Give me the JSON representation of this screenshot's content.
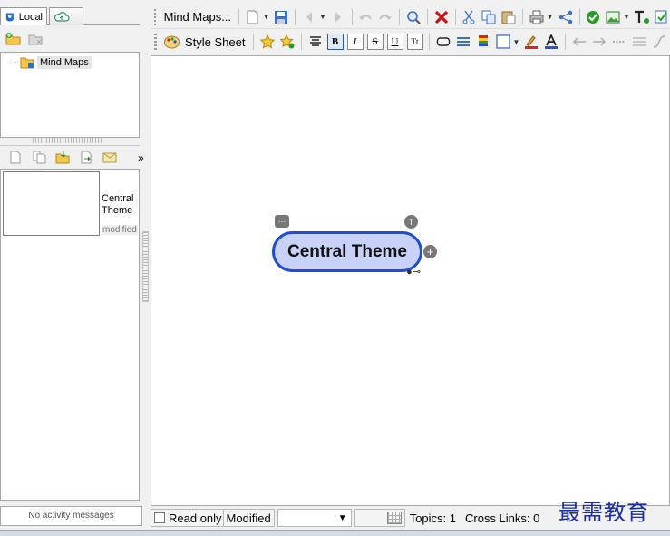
{
  "left_panel": {
    "tabs": [
      {
        "label": "Local",
        "icon": "local-library-icon"
      },
      {
        "label": "",
        "icon": "cloud-icon"
      }
    ],
    "tree": {
      "item_label": "Mind Maps"
    },
    "file": {
      "title": "Central Theme",
      "status": "modified"
    },
    "activity": "No activity messages"
  },
  "toolbar": {
    "mindmaps_label": "Mind Maps...",
    "style_sheet_label": "Style Sheet",
    "format": {
      "bold": "B",
      "italic": "I",
      "strike": "S",
      "underline": "U",
      "case": "Tt"
    }
  },
  "canvas": {
    "central_topic": "Central Theme"
  },
  "statusbar": {
    "read_only": "Read only",
    "modified": "Modified",
    "topics": "Topics: 1",
    "cross_links": "Cross Links: 0"
  },
  "watermark": "最需教育",
  "colors": {
    "topic_fill": "#c8d2f8",
    "topic_border": "#1f4fcf",
    "delete_red": "#cc1111",
    "check_green": "#2a9a2a"
  }
}
